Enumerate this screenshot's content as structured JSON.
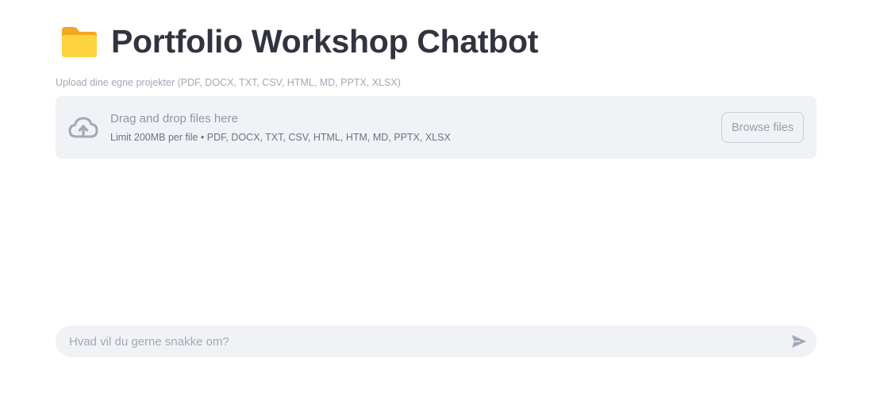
{
  "header": {
    "emoji": "folder-icon",
    "title": "Portfolio Workshop Chatbot"
  },
  "uploader": {
    "label": "Upload dine egne projekter (PDF, DOCX, TXT, CSV, HTML, MD, PPTX, XLSX)",
    "instructions": "Drag and drop files here",
    "limit": "Limit 200MB per file • PDF, DOCX, TXT, CSV, HTML, HTM, MD, PPTX, XLSX",
    "browse_label": "Browse files",
    "icon": "cloud-upload-icon"
  },
  "chat": {
    "placeholder": "Hvad vil du gerne snakke om?",
    "value": "",
    "send_icon": "send-icon"
  },
  "colors": {
    "text": "#31333f",
    "muted": "#a3a8b4",
    "panel": "#f0f2f6",
    "folder": "#ffc83d"
  }
}
